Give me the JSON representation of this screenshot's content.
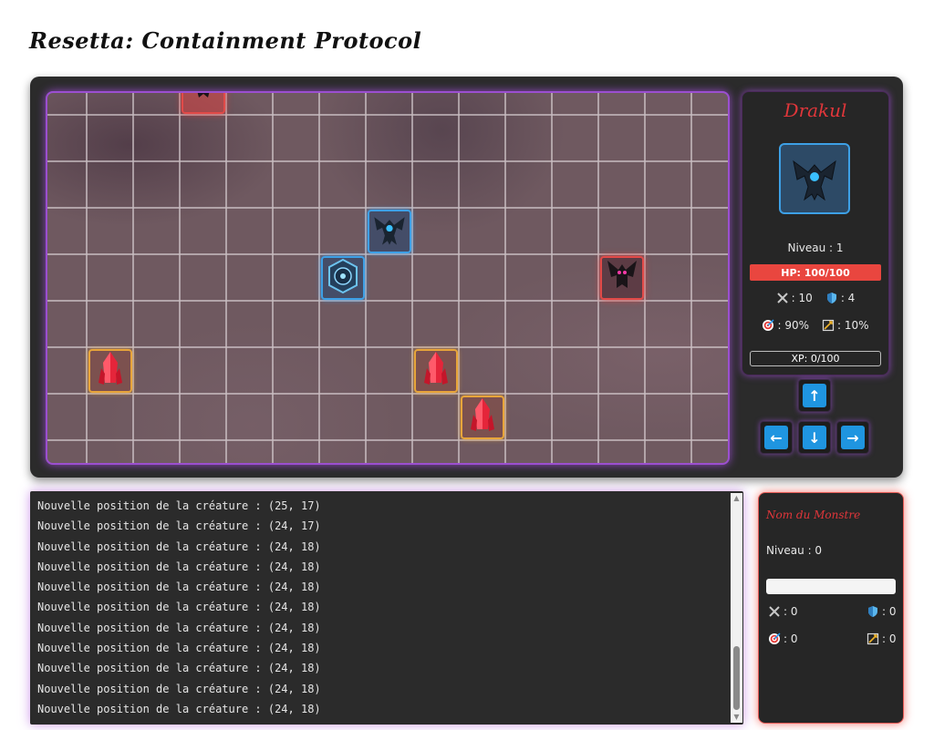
{
  "title": "Resetta: Containment Protocol",
  "character": {
    "name": "Drakul",
    "level_label": "Niveau : 1",
    "hp_label": "HP: 100/100",
    "attack": ": 10",
    "defense": ": 4",
    "accuracy": ": 90%",
    "critical": ": 10%",
    "xp_label": "XP: 0/100",
    "portrait_icon": "bat-demon-icon"
  },
  "controls": {
    "up": "↑",
    "left": "←",
    "down": "↓",
    "right": "→"
  },
  "board": {
    "columns": 15,
    "rows": 8,
    "entities": [
      {
        "type": "monster",
        "icon": "demon-icon",
        "col": 3,
        "row": 0
      },
      {
        "type": "player",
        "icon": "bat-demon-icon",
        "col": 7,
        "row": 3
      },
      {
        "type": "shield",
        "icon": "shield-rune-icon",
        "col": 6,
        "row": 4
      },
      {
        "type": "monster",
        "icon": "winged-demon-icon",
        "col": 12,
        "row": 4
      },
      {
        "type": "crystal",
        "icon": "red-crystal-icon",
        "col": 1,
        "row": 6
      },
      {
        "type": "crystal",
        "icon": "red-crystal-icon",
        "col": 8,
        "row": 6
      },
      {
        "type": "crystal",
        "icon": "red-crystal-icon",
        "col": 9,
        "row": 7
      }
    ]
  },
  "log": {
    "lines": [
      "Nouvelle position de la créature : (25, 17)",
      "Nouvelle position de la créature : (24, 17)",
      "Nouvelle position de la créature : (24, 18)",
      "Nouvelle position de la créature : (24, 18)",
      "Nouvelle position de la créature : (24, 18)",
      "Nouvelle position de la créature : (24, 18)",
      "Nouvelle position de la créature : (24, 18)",
      "Nouvelle position de la créature : (24, 18)",
      "Nouvelle position de la créature : (24, 18)",
      "Nouvelle position de la créature : (24, 18)",
      "Nouvelle position de la créature : (24, 18)"
    ]
  },
  "monster": {
    "name": "Nom du Monstre",
    "level_label": "Niveau : 0",
    "attack": ": 0",
    "defense": ": 0",
    "accuracy": ": 0",
    "critical": ": 0"
  }
}
